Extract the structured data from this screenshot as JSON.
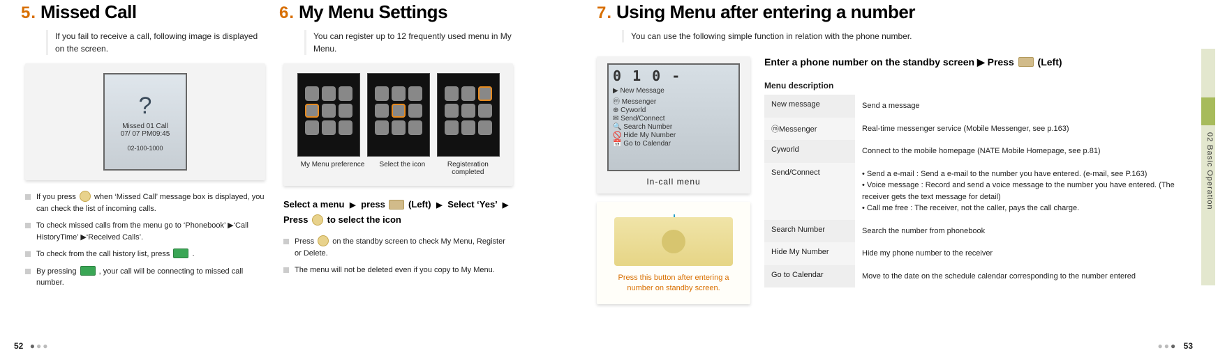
{
  "section5": {
    "num": "5.",
    "title": "Missed Call",
    "sub": "If you fail to receive a call, following image is displayed on the screen.",
    "screen": {
      "line1": "Missed 01 Call",
      "line2": "07/ 07  PM09:45",
      "line3": "02-100-1000"
    },
    "bul1a": "If you press ",
    "bul1b": " when  ‘Missed Call’ message box is displayed, you can check the list of incoming calls.",
    "bul2": "To check missed calls from the menu go to ‘Phonebook’ ▶‘Call HistoryTime’ ▶‘Received Calls’.",
    "bul3a": "To check from the call history list, press ",
    "bul3b": " .",
    "bul4a": "By pressing ",
    "bul4b": " , your call will be connecting to missed call number."
  },
  "section6": {
    "num": "6.",
    "title": "My Menu Settings",
    "sub": "You can register up to 12 frequently used menu in My Menu.",
    "cap1": "My Menu preference",
    "cap2": "Select the icon",
    "cap3": "Registeration completed",
    "instruct": "Select a menu ▶  press      (Left)  ▶ Select ‘Yes’ ▶ Press       to select the icon",
    "bul1a": "Press ",
    "bul1b": " on the standby screen to check My Menu, Register or Delete.",
    "bul2": "The menu will not be deleted even if you copy to My Menu."
  },
  "section7": {
    "num": "7.",
    "title": "Using Menu after entering a number",
    "sub": "You can use the following simple function in relation with the phone number.",
    "incall": {
      "big": "0 1 0 -",
      "rows": [
        "▶ New Message",
        "ⓜ Messenger",
        "⊕ Cyworld",
        "✉ Send/Connect",
        "🔍 Search Number",
        "🚫 Hide My Number",
        "📅 Go to Calendar"
      ],
      "caption": "In-call menu"
    },
    "keycaption": "Press this button after entering a number on standby screen.",
    "enter_line_a": "Enter a phone number on the standby screen  ▶  Press ",
    "enter_line_b": " (Left)",
    "menu_desc_label": "Menu description",
    "table": [
      {
        "k": "New message",
        "v": "Send a message"
      },
      {
        "k": "ⓜMessenger",
        "v": "Real-time messenger service (Mobile Messenger, see p.163)"
      },
      {
        "k": "Cyworld",
        "v": "Connect to the mobile homepage (NATE Mobile Homepage, see p.81)"
      },
      {
        "k": "Send/Connect",
        "v": [
          "Send a e-mail : Send a e-mail to the number you have entered. (e-mail, see P.163)",
          "Voice message : Record and send a voice message to the number you have entered. (The receiver gets the text message for detail)",
          "Call me free : The receiver, not the caller, pays the call charge."
        ]
      },
      {
        "k": "Search Number",
        "v": "Search the number from phonebook"
      },
      {
        "k": "Hide My Number",
        "v": "Hide my phone number to the receiver"
      },
      {
        "k": "Go to Calendar",
        "v": "Move to the date on the schedule calendar corresponding to the number entered"
      }
    ]
  },
  "edge_label": "02  Basic Operation",
  "page_left": "52",
  "page_right": "53"
}
